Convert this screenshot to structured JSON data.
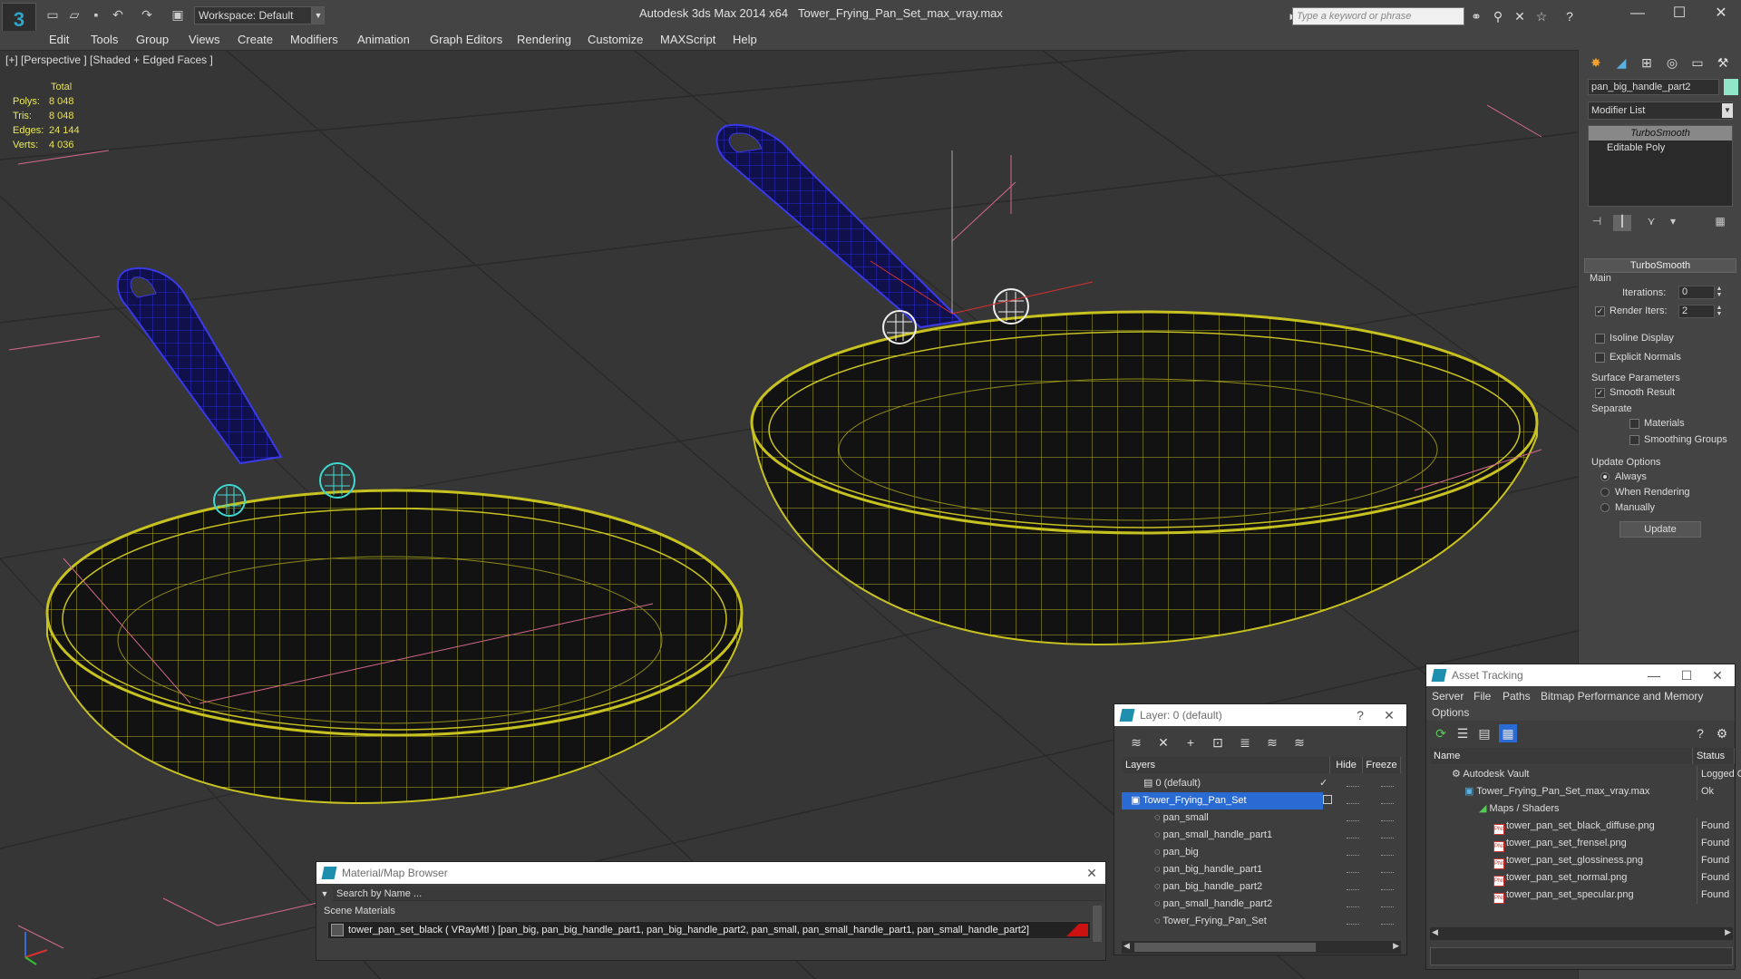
{
  "titlebar": {
    "workspace_label": "Workspace: Default",
    "app_title": "Autodesk 3ds Max  2014 x64",
    "doc_title": "Tower_Frying_Pan_Set_max_vray.max",
    "search_placeholder": "Type a keyword or phrase"
  },
  "menu": [
    "Edit",
    "Tools",
    "Group",
    "Views",
    "Create",
    "Modifiers",
    "Animation",
    "Graph Editors",
    "Rendering",
    "Customize",
    "MAXScript",
    "Help"
  ],
  "viewport": {
    "label": "[+] [Perspective ] [Shaded + Edged Faces ]",
    "stats": {
      "header": "Total",
      "rows": [
        {
          "label": "Polys:",
          "value": "8 048"
        },
        {
          "label": "Tris:",
          "value": "8 048"
        },
        {
          "label": "Edges:",
          "value": "24 144"
        },
        {
          "label": "Verts:",
          "value": "4 036"
        }
      ]
    }
  },
  "command_panel": {
    "object_name": "pan_big_handle_part2",
    "modifier_list": "Modifier List",
    "stack": [
      "TurboSmooth",
      "Editable Poly"
    ],
    "rollout_title": "TurboSmooth",
    "main_label": "Main",
    "iterations_label": "Iterations:",
    "iterations_value": "0",
    "render_iters_label": "Render Iters:",
    "render_iters_value": "2",
    "isoline_label": "Isoline Display",
    "explicit_normals_label": "Explicit Normals",
    "surface_label": "Surface Parameters",
    "smooth_result_label": "Smooth Result",
    "separate_label": "Separate",
    "materials_label": "Materials",
    "smoothing_groups_label": "Smoothing Groups",
    "update_options_label": "Update Options",
    "always_label": "Always",
    "when_rendering_label": "When Rendering",
    "manually_label": "Manually",
    "update_button": "Update"
  },
  "material_browser": {
    "title": "Material/Map Browser",
    "search_placeholder": "Search by Name ...",
    "section": "Scene Materials",
    "material_row": "tower_pan_set_black  ( VRayMtl ) [pan_big, pan_big_handle_part1, pan_big_handle_part2, pan_small, pan_small_handle_part1, pan_small_handle_part2]"
  },
  "layer_window": {
    "title": "Layer: 0 (default)",
    "help": "?",
    "columns": [
      "Layers",
      "Hide",
      "Freeze"
    ],
    "rows": [
      {
        "name": "0 (default)",
        "indent": 1,
        "selected": false
      },
      {
        "name": "Tower_Frying_Pan_Set",
        "indent": 1,
        "selected": true
      },
      {
        "name": "pan_small",
        "indent": 2,
        "selected": false
      },
      {
        "name": "pan_small_handle_part1",
        "indent": 2,
        "selected": false
      },
      {
        "name": "pan_big",
        "indent": 2,
        "selected": false
      },
      {
        "name": "pan_big_handle_part1",
        "indent": 2,
        "selected": false
      },
      {
        "name": "pan_big_handle_part2",
        "indent": 2,
        "selected": false
      },
      {
        "name": "pan_small_handle_part2",
        "indent": 2,
        "selected": false
      },
      {
        "name": "Tower_Frying_Pan_Set",
        "indent": 2,
        "selected": false
      }
    ]
  },
  "asset_tracking": {
    "title": "Asset Tracking",
    "menu": [
      "Server",
      "File",
      "Paths",
      "Bitmap Performance and Memory"
    ],
    "menu2": "Options",
    "columns": [
      "Name",
      "Status"
    ],
    "rows": [
      {
        "name": "Autodesk Vault",
        "status": "Logged O",
        "indent": 1,
        "type": "vault"
      },
      {
        "name": "Tower_Frying_Pan_Set_max_vray.max",
        "status": "Ok",
        "indent": 2,
        "type": "max"
      },
      {
        "name": "Maps / Shaders",
        "status": "",
        "indent": 3,
        "type": "folder"
      },
      {
        "name": "tower_pan_set_black_diffuse.png",
        "status": "Found",
        "indent": 4,
        "type": "png"
      },
      {
        "name": "tower_pan_set_frensel.png",
        "status": "Found",
        "indent": 4,
        "type": "png"
      },
      {
        "name": "tower_pan_set_glossiness.png",
        "status": "Found",
        "indent": 4,
        "type": "png"
      },
      {
        "name": "tower_pan_set_normal.png",
        "status": "Found",
        "indent": 4,
        "type": "png"
      },
      {
        "name": "tower_pan_set_specular.png",
        "status": "Found",
        "indent": 4,
        "type": "png"
      }
    ]
  }
}
